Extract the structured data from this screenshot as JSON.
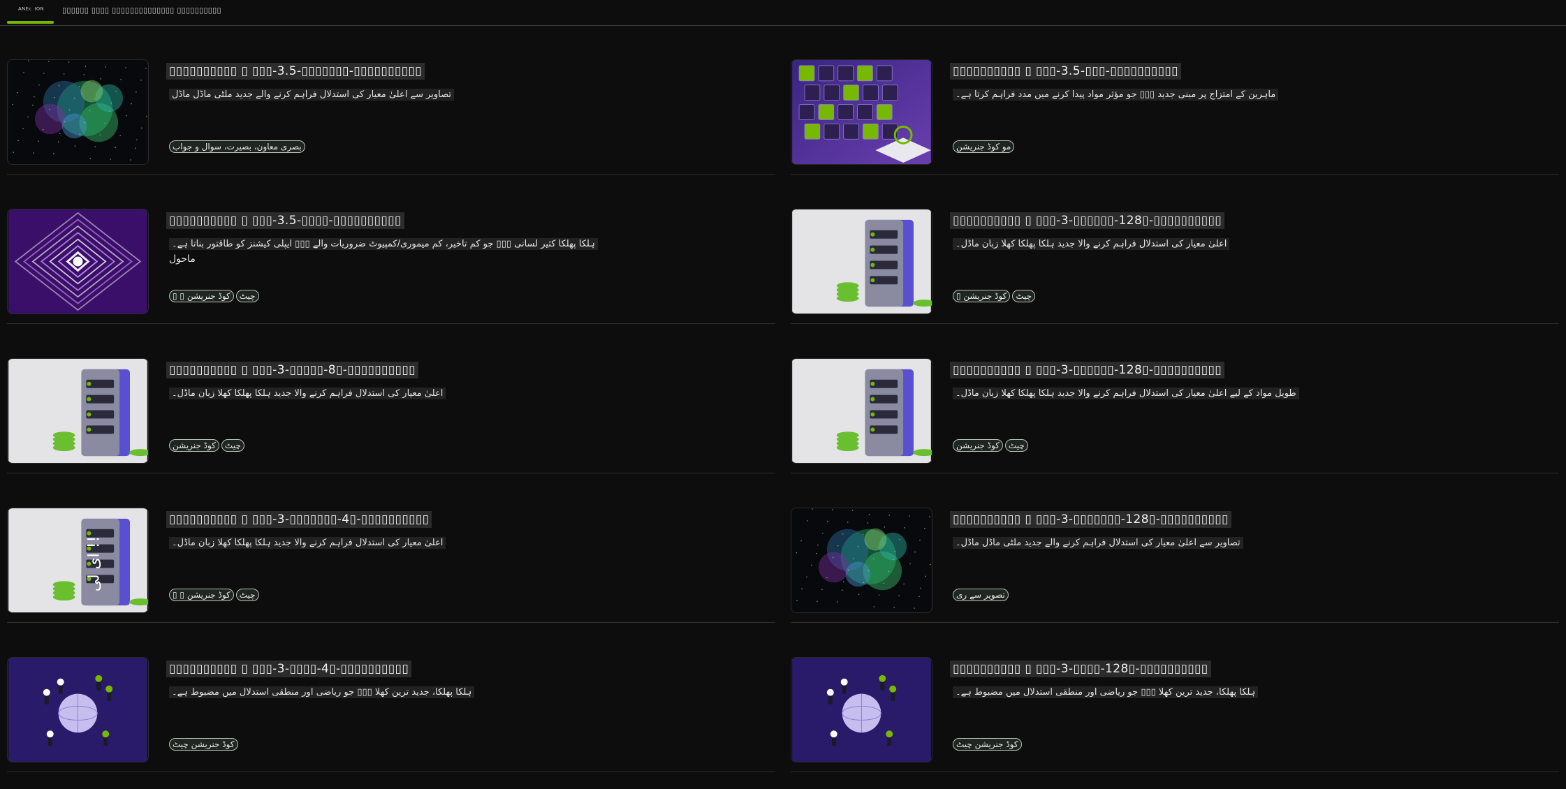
{
  "tabs": [
    {
      "label": "ᴬᴺᴱᶜ ᴵᴼᴺ"
    },
    {
      "label": "▯▯▯▯▯▯ ▯▯▯▯ ▯▯▯▯"
    },
    {
      "label": "▯▯▯▯▯▯▯▯▯▯ ▯▯▯▯▯▯▯▯▯▯"
    }
  ],
  "cards": [
    {
      "title": "▯▯▯▯▯▯▯▯▯▯ ▯ ▯▯▯-3.5-▯▯▯▯▯▯▯-▯▯▯▯▯▯▯▯▯▯",
      "desc": "تصاویر سے اعلیٰ معیار کی استدلال فراہم کرنے والے جدید ملٹی ماڈل ماڈل",
      "sub": "",
      "tags": [
        "بصری معاون، بصیرت، سوال و جواب"
      ],
      "thumb": "nebula"
    },
    {
      "title": "▯▯▯▯▯▯▯▯▯▯ ▯ ▯▯▯-3.5-▯▯▯-▯▯▯▯▯▯▯▯▯▯",
      "desc": "ماہرین کے امتزاج پر مبنی جدید ▯▯▯ جو مؤثر مواد پیدا کرنے میں مدد فراہم کرتا ہے۔",
      "sub": "",
      "tags": [
        "مو کوڈ جنریشن"
      ],
      "thumb": "cubes"
    },
    {
      "title": "▯▯▯▯▯▯▯▯▯▯ ▯ ▯▯▯-3.5-▯▯▯▯-▯▯▯▯▯▯▯▯▯▯",
      "desc": "ہلکا پھلکا کثیر لسانی ▯▯▯ جو کم تاخیر، کم میموری/کمپیوٹ ضروریات والے ▯▯▯ ایپلی کیشنز کو طاقتور بناتا ہے۔",
      "sub": "ماحول",
      "tags": [
        "کوڈ جنریشن ▯ ▯",
        "چیٹ"
      ],
      "thumb": "tunnel"
    },
    {
      "title": "▯▯▯▯▯▯▯▯▯▯ ▯ ▯▯▯-3-▯▯▯▯▯▯-128▯-▯▯▯▯▯▯▯▯▯▯",
      "desc": "اعلیٰ معیار کی استدلال فراہم کرنے والا جدید ہلکا پھلکا کھلا زبان ماڈل۔",
      "sub": "",
      "tags": [
        "کوڈ جنریشن ▯",
        "چیٹ"
      ],
      "thumb": "server"
    },
    {
      "title": "▯▯▯▯▯▯▯▯▯▯ ▯ ▯▯▯-3-▯▯▯▯▯-8▯-▯▯▯▯▯▯▯▯▯▯",
      "desc": "اعلیٰ معیار کی استدلال فراہم کرنے والا جدید ہلکا پھلکا کھلا زبان ماڈل۔",
      "sub": "",
      "tags": [
        "کوڈ جنریشن",
        "چیٹ"
      ],
      "thumb": "server"
    },
    {
      "title": "▯▯▯▯▯▯▯▯▯▯ ▯ ▯▯▯-3-▯▯▯▯▯▯-128▯-▯▯▯▯▯▯▯▯▯▯",
      "desc": "طویل مواد کے لیے اعلیٰ معیار کی استدلال فراہم کرنے والا جدید ہلکا پھلکا کھلا زبان ماڈل۔",
      "sub": "",
      "tags": [
        "کوڈ جنریشن",
        "چیٹ"
      ],
      "thumb": "server"
    },
    {
      "title": "▯▯▯▯▯▯▯▯▯▯ ▯ ▯▯▯-3-▯▯▯▯▯▯▯-4▯-▯▯▯▯▯▯▯▯▯▯",
      "desc": "اعلیٰ معیار کی استدلال فراہم کرنے والا جدید ہلکا پھلکا کھلا زبان ماڈل۔",
      "sub": "",
      "tags": [
        "کوڈ جنریشن ▯ ▯",
        "چیٹ"
      ],
      "thumb": "server-label",
      "thumb_label": "ای لی !!"
    },
    {
      "title": "▯▯▯▯▯▯▯▯▯▯ ▯ ▯▯▯-3-▯▯▯▯▯▯▯-128▯-▯▯▯▯▯▯▯▯▯▯",
      "desc": "تصاویر سے اعلیٰ معیار کی استدلال فراہم کرنے والے جدید ملٹی ماڈل ماڈل۔",
      "sub": "",
      "tags": [
        "تصویر سے ری"
      ],
      "thumb": "nebula"
    },
    {
      "title": "▯▯▯▯▯▯▯▯▯▯ ▯ ▯▯▯-3-▯▯▯▯-4▯-▯▯▯▯▯▯▯▯▯▯",
      "desc": "ہلکا پھلکا، جدید ترین کھلا ▯▯▯ جو ریاضی اور منطقی استدلال میں مضبوط ہے۔",
      "sub": "",
      "tags": [
        "کوڈ جنریشن چیٹ"
      ],
      "thumb": "globe"
    },
    {
      "title": "▯▯▯▯▯▯▯▯▯▯ ▯ ▯▯▯-3-▯▯▯▯-128▯-▯▯▯▯▯▯▯▯▯▯",
      "desc": "ہلکا پھلکا، جدید ترین کھلا ▯▯▯ جو ریاضی اور منطقی استدلال میں مضبوط ہے۔",
      "sub": "",
      "tags": [
        "کوڈ جنریشن چیٹ"
      ],
      "thumb": "globe"
    }
  ],
  "colors": {
    "background": "#0d0d0d",
    "accent": "#76b900",
    "tag_border": "#b8c4b8"
  }
}
